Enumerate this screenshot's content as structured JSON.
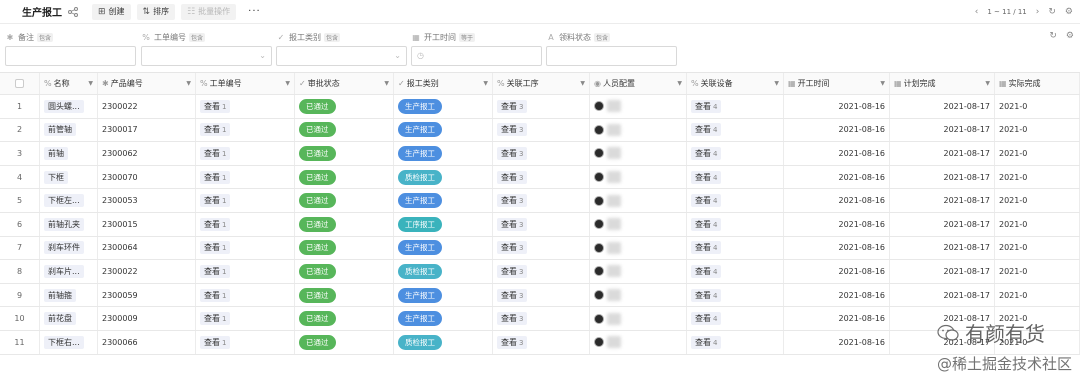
{
  "toolbar": {
    "title": "生产报工",
    "create_label": "创建",
    "sort_label": "排序",
    "batch_label": "批量操作",
    "more_label": "···"
  },
  "pager": {
    "range": "1 ~ 11 / 11"
  },
  "filters": [
    {
      "label": "备注",
      "op": "包含",
      "icon": "asterisk-icon",
      "type": "text"
    },
    {
      "label": "工单编号",
      "op": "包含",
      "icon": "link-icon",
      "type": "select"
    },
    {
      "label": "报工类别",
      "op": "包含",
      "icon": "check-circle-icon",
      "type": "select"
    },
    {
      "label": "开工时间",
      "op": "等于",
      "icon": "calendar-icon",
      "type": "date"
    },
    {
      "label": "领料状态",
      "op": "包含",
      "icon": "text-icon",
      "type": "text"
    }
  ],
  "columns": [
    "名称",
    "产品编号",
    "工单编号",
    "审批状态",
    "报工类别",
    "关联工序",
    "人员配置",
    "关联设备",
    "开工时间",
    "计划完成",
    "实际完成"
  ],
  "rows": [
    {
      "num": "1",
      "name": "圆头螺...",
      "product": "2300022",
      "order": "查看",
      "order_n": "1",
      "status": "已通过",
      "category": "生产报工",
      "cat_color": "blue",
      "process": "查看",
      "process_n": "3",
      "device": "查看",
      "device_n": "4",
      "start": "2021-08-16",
      "plan": "2021-08-17",
      "actual": "2021-0"
    },
    {
      "num": "2",
      "name": "前管轴",
      "product": "2300017",
      "order": "查看",
      "order_n": "1",
      "status": "已通过",
      "category": "生产报工",
      "cat_color": "blue",
      "process": "查看",
      "process_n": "3",
      "device": "查看",
      "device_n": "4",
      "start": "2021-08-16",
      "plan": "2021-08-17",
      "actual": "2021-0"
    },
    {
      "num": "3",
      "name": "前轴",
      "product": "2300062",
      "order": "查看",
      "order_n": "1",
      "status": "已通过",
      "category": "生产报工",
      "cat_color": "blue",
      "process": "查看",
      "process_n": "3",
      "device": "查看",
      "device_n": "4",
      "start": "2021-08-16",
      "plan": "2021-08-17",
      "actual": "2021-0"
    },
    {
      "num": "4",
      "name": "下框",
      "product": "2300070",
      "order": "查看",
      "order_n": "1",
      "status": "已通过",
      "category": "质检报工",
      "cat_color": "teal",
      "process": "查看",
      "process_n": "3",
      "device": "查看",
      "device_n": "4",
      "start": "2021-08-16",
      "plan": "2021-08-17",
      "actual": "2021-0"
    },
    {
      "num": "5",
      "name": "下框左...",
      "product": "2300053",
      "order": "查看",
      "order_n": "1",
      "status": "已通过",
      "category": "生产报工",
      "cat_color": "blue",
      "process": "查看",
      "process_n": "3",
      "device": "查看",
      "device_n": "4",
      "start": "2021-08-16",
      "plan": "2021-08-17",
      "actual": "2021-0"
    },
    {
      "num": "6",
      "name": "前轴孔夹",
      "product": "2300015",
      "order": "查看",
      "order_n": "1",
      "status": "已通过",
      "category": "工序报工",
      "cat_color": "cyan",
      "process": "查看",
      "process_n": "3",
      "device": "查看",
      "device_n": "4",
      "start": "2021-08-16",
      "plan": "2021-08-17",
      "actual": "2021-0"
    },
    {
      "num": "7",
      "name": "刹车环件",
      "product": "2300064",
      "order": "查看",
      "order_n": "1",
      "status": "已通过",
      "category": "生产报工",
      "cat_color": "blue",
      "process": "查看",
      "process_n": "3",
      "device": "查看",
      "device_n": "4",
      "start": "2021-08-16",
      "plan": "2021-08-17",
      "actual": "2021-0"
    },
    {
      "num": "8",
      "name": "刹车片...",
      "product": "2300022",
      "order": "查看",
      "order_n": "1",
      "status": "已通过",
      "category": "质检报工",
      "cat_color": "teal",
      "process": "查看",
      "process_n": "3",
      "device": "查看",
      "device_n": "4",
      "start": "2021-08-16",
      "plan": "2021-08-17",
      "actual": "2021-0"
    },
    {
      "num": "9",
      "name": "前轴箍",
      "product": "2300059",
      "order": "查看",
      "order_n": "1",
      "status": "已通过",
      "category": "生产报工",
      "cat_color": "blue",
      "process": "查看",
      "process_n": "3",
      "device": "查看",
      "device_n": "4",
      "start": "2021-08-16",
      "plan": "2021-08-17",
      "actual": "2021-0"
    },
    {
      "num": "10",
      "name": "前花盘",
      "product": "2300009",
      "order": "查看",
      "order_n": "1",
      "status": "已通过",
      "category": "生产报工",
      "cat_color": "blue",
      "process": "查看",
      "process_n": "3",
      "device": "查看",
      "device_n": "4",
      "start": "2021-08-16",
      "plan": "2021-08-17",
      "actual": "2021-0"
    },
    {
      "num": "11",
      "name": "下框右...",
      "product": "2300066",
      "order": "查看",
      "order_n": "1",
      "status": "已通过",
      "category": "质检报工",
      "cat_color": "teal",
      "process": "查看",
      "process_n": "3",
      "device": "查看",
      "device_n": "4",
      "start": "2021-08-16",
      "plan": "2021-08-17",
      "actual": "2021-0"
    }
  ],
  "colors": {
    "approved": "#57b65a",
    "production": "#4d8fe0",
    "quality": "#48b3c8",
    "process": "#3ab3bc"
  },
  "watermark": {
    "line1": "有颜有货",
    "line2": "@稀土掘金技术社区"
  }
}
